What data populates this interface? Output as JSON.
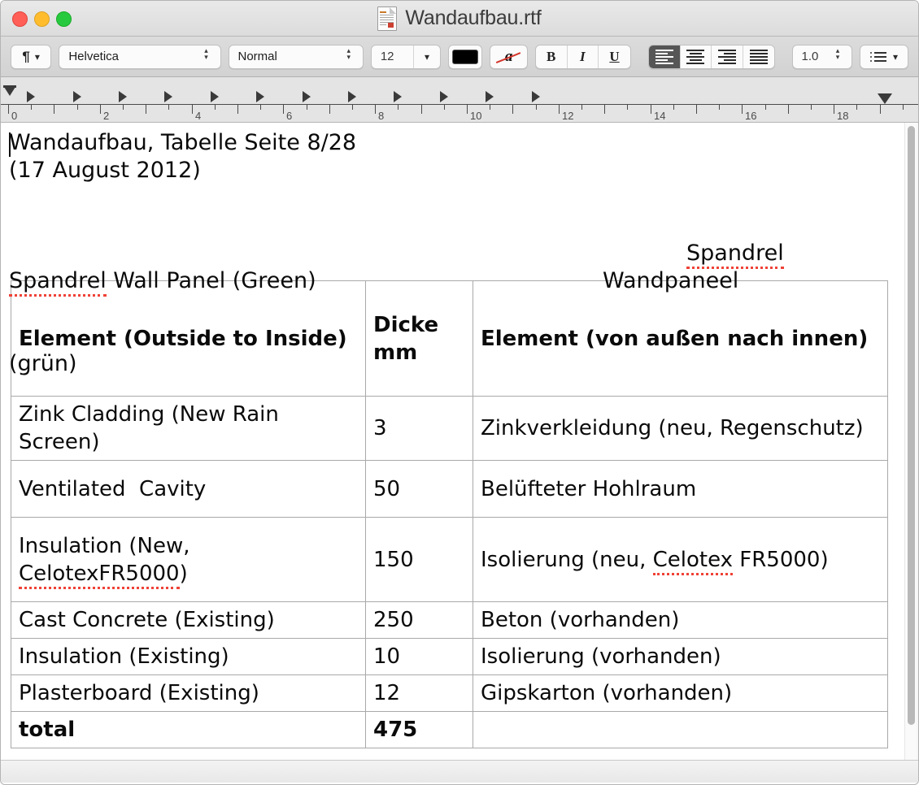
{
  "window": {
    "title": "Wandaufbau.rtf",
    "traffic_lights": [
      "close",
      "minimize",
      "zoom"
    ],
    "doc_icon": "rtf-document-icon"
  },
  "toolbar": {
    "paragraph_style_icon": "pilcrow-icon",
    "font_family": "Helvetica",
    "paragraph_style": "Normal",
    "font_size": "12",
    "text_color": "#000000",
    "background_color_label": "a",
    "bold": "B",
    "italic": "I",
    "underline": "U",
    "align_left": "align-left",
    "align_center": "align-center",
    "align_right": "align-right",
    "align_justify": "align-justify",
    "line_spacing": "1.0",
    "list_style_icon": "list-icon"
  },
  "ruler": {
    "unit_labels": [
      "0",
      "2",
      "4",
      "6",
      "8",
      "10",
      "12",
      "14",
      "16",
      "18"
    ],
    "tab_positions_in": [
      0.5,
      1.5,
      2.5,
      3.5,
      4.5,
      5.5,
      6.5,
      7.5,
      8.5,
      9.5,
      10.5,
      11.5
    ],
    "left_margin_in": 0,
    "right_margin_in": 19.1
  },
  "document": {
    "line1": "Wandaufbau, Tabelle Seite 8/28",
    "line2": "(17 August 2012)",
    "heading_en_spell": "Spandrel",
    "heading_en_rest": " Wall Panel (Green)",
    "heading_en_line2": "(grün)",
    "heading_de_spell": "Spandrel",
    "heading_de_rest": " Wandpaneel",
    "table": {
      "headers": [
        "Element (Outside to Inside)",
        "Dicke mm",
        "Element (von außen nach innen)"
      ],
      "rows": [
        {
          "en": "Zink Cladding (New Rain Screen)",
          "mm": "3",
          "de": "Zinkverkleidung (neu, Regenschutz)"
        },
        {
          "en": "Ventilated  Cavity",
          "mm": "50",
          "de": "Belüfteter Hohlraum"
        },
        {
          "en_prefix": "Insulation (New, ",
          "en_spell": "CelotexFR5000",
          "en_suffix": ")",
          "mm": "150",
          "de_prefix": "Isolierung (neu, ",
          "de_spell": "Celotex",
          "de_suffix": " FR5000)"
        },
        {
          "en": "Cast Concrete (Existing)",
          "mm": "250",
          "de": "Beton (vorhanden)"
        },
        {
          "en": "Insulation (Existing)",
          "mm": "10",
          "de": "Isolierung (vorhanden)"
        },
        {
          "en": "Plasterboard (Existing)",
          "mm": "12",
          "de": "Gipskarton (vorhanden)"
        }
      ],
      "total_label": "total",
      "total_mm": "475",
      "total_de": ""
    }
  }
}
